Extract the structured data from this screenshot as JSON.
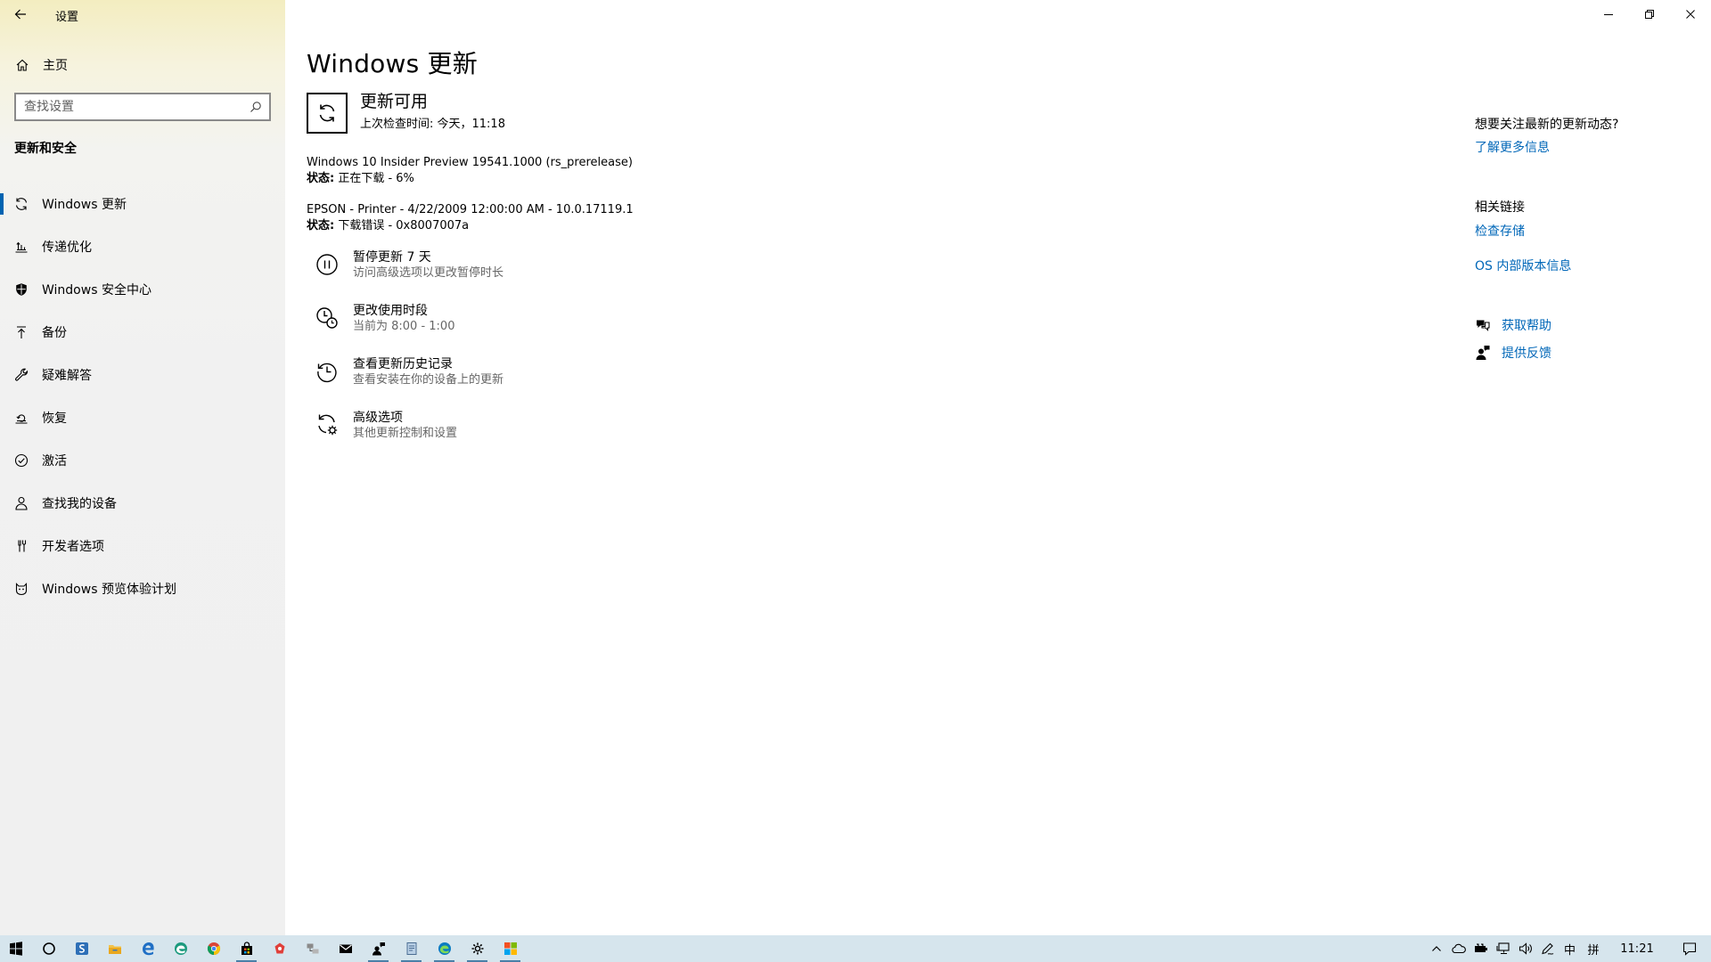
{
  "window": {
    "app_title": "设置",
    "colors": {
      "accent": "#0063b1",
      "link": "#0067b8",
      "taskbar": "#d6e5ed"
    }
  },
  "sidebar": {
    "home_label": "主页",
    "search_placeholder": "查找设置",
    "section_title": "更新和安全",
    "items": [
      {
        "label": "Windows 更新",
        "icon": "sync-icon",
        "active": true
      },
      {
        "label": "传递优化",
        "icon": "delivery-optimization-icon"
      },
      {
        "label": "Windows 安全中心",
        "icon": "shield-icon"
      },
      {
        "label": "备份",
        "icon": "backup-arrow-icon"
      },
      {
        "label": "疑难解答",
        "icon": "wrench-icon"
      },
      {
        "label": "恢复",
        "icon": "recovery-icon"
      },
      {
        "label": "激活",
        "icon": "check-circle-icon"
      },
      {
        "label": "查找我的设备",
        "icon": "person-location-icon"
      },
      {
        "label": "开发者选项",
        "icon": "developer-tools-icon"
      },
      {
        "label": "Windows 预览体验计划",
        "icon": "insider-cat-icon"
      }
    ]
  },
  "main": {
    "page_title": "Windows 更新",
    "status": {
      "heading": "更新可用",
      "last_check": "上次检查时间: 今天，11:18"
    },
    "updates": [
      {
        "name": "Windows 10 Insider Preview 19541.1000 (rs_prerelease)",
        "status_label": "状态:",
        "status_value": " 正在下载 - 6%"
      },
      {
        "name": "EPSON - Printer - 4/22/2009 12:00:00 AM - 10.0.17119.1",
        "status_label": "状态:",
        "status_value": " 下载错误 - 0x8007007a"
      }
    ],
    "actions": [
      {
        "title": "暂停更新 7 天",
        "desc": "访问高级选项以更改暂停时长",
        "icon": "pause-icon"
      },
      {
        "title": "更改使用时段",
        "desc": "当前为 8:00 - 1:00",
        "icon": "active-hours-clock-icon"
      },
      {
        "title": "查看更新历史记录",
        "desc": "查看安装在你的设备上的更新",
        "icon": "history-icon"
      },
      {
        "title": "高级选项",
        "desc": "其他更新控制和设置",
        "icon": "advanced-sync-gear-icon"
      }
    ]
  },
  "right_panel": {
    "news_heading": "想要关注最新的更新动态?",
    "learn_more": "了解更多信息",
    "related_heading": "相关链接",
    "check_storage": "检查存储",
    "os_build_info": "OS 内部版本信息",
    "get_help": "获取帮助",
    "give_feedback": "提供反馈"
  },
  "taskbar": {
    "apps": [
      "start-icon",
      "cortana-icon",
      "app-s-icon",
      "file-explorer-icon",
      "edge-icon",
      "edge-beta-icon",
      "chrome-icon",
      "store-icon",
      "red-app-icon",
      "network-app-icon",
      "mail-icon",
      "people-app-icon",
      "notepad-icon",
      "edge-dev-icon",
      "settings-gear-icon",
      "tiles-app-icon"
    ],
    "tray": {
      "ime_lang": "中",
      "ime_mode": "拼",
      "clock": "11:21"
    }
  }
}
